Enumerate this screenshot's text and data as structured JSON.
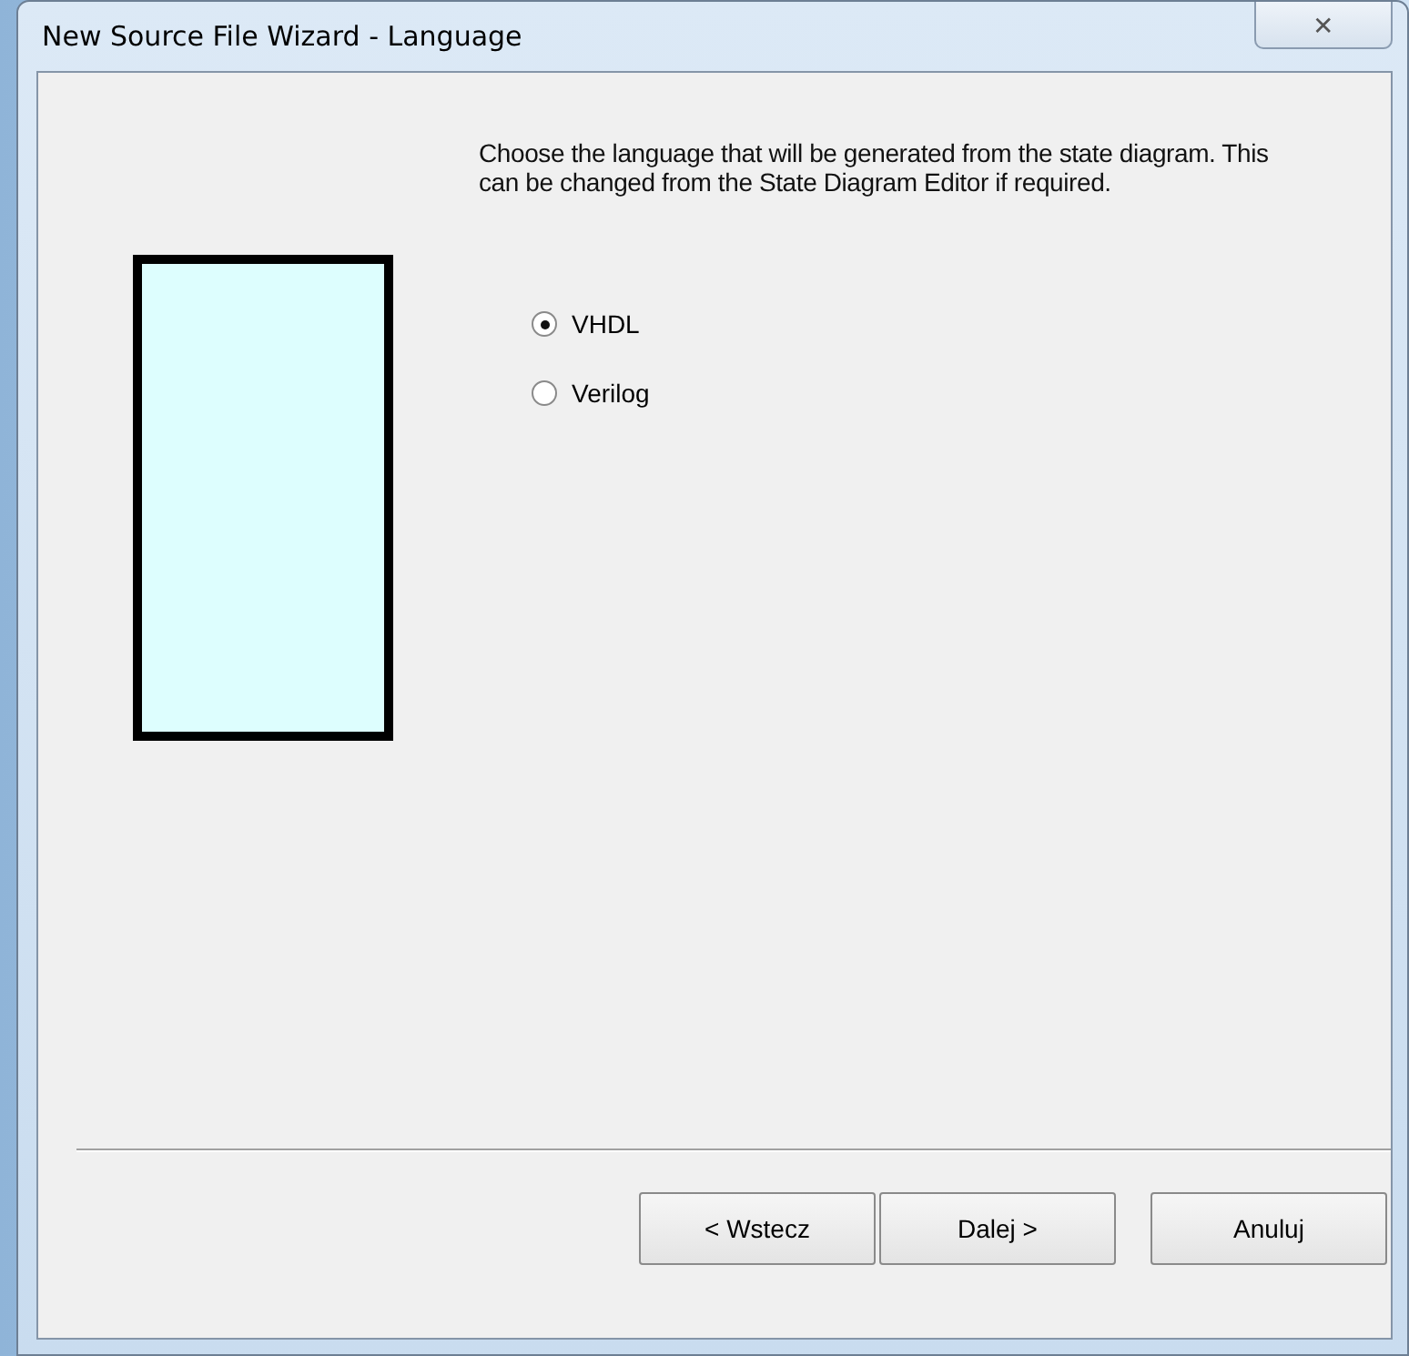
{
  "window": {
    "title": "New Source File Wizard - Language",
    "close_label": "✕"
  },
  "description": "Choose the language that will be generated from the state diagram. This can be changed from the State Diagram Editor if required.",
  "options": [
    {
      "label": "VHDL",
      "selected": true
    },
    {
      "label": "Verilog",
      "selected": false
    }
  ],
  "buttons": [
    {
      "label": "< Wstecz"
    },
    {
      "label": "Dalej >"
    },
    {
      "label": "Anuluj"
    }
  ]
}
